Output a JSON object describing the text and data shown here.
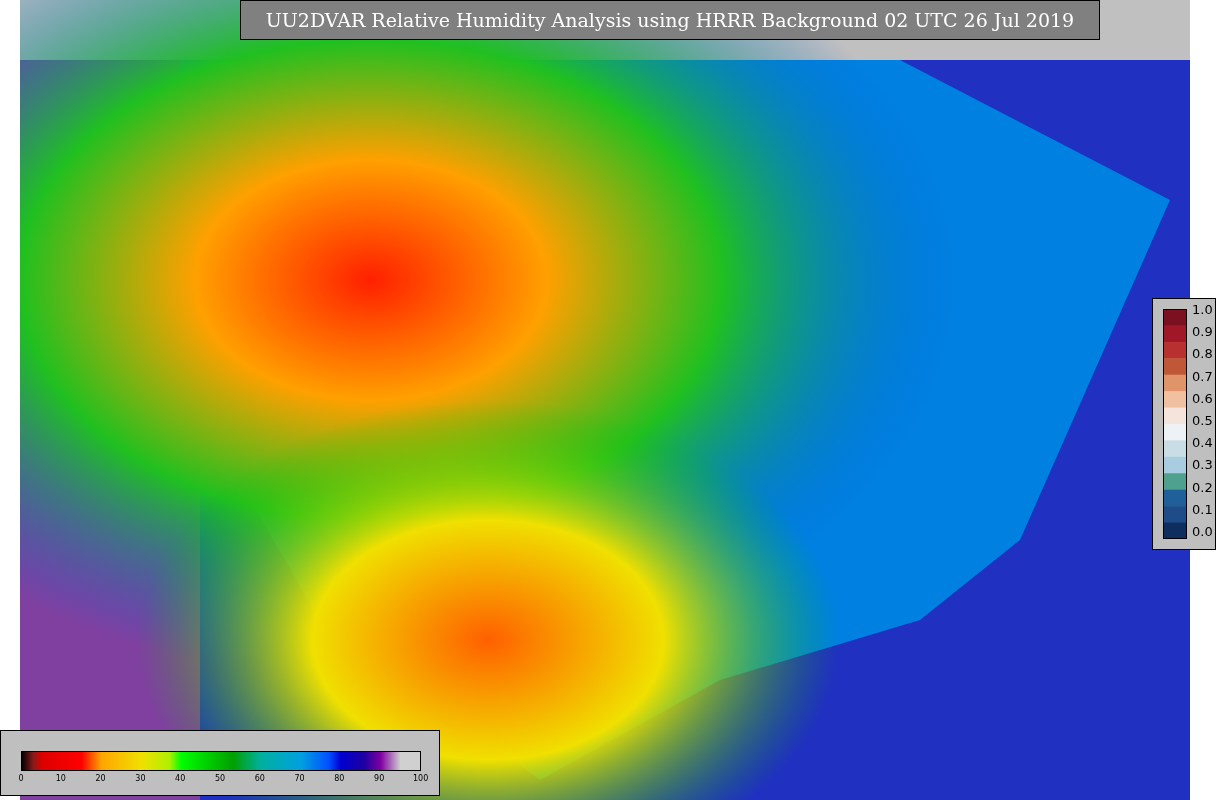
{
  "title": "UU2DVAR Relative Humidity Analysis using HRRR Background 02 UTC 26 Jul 2019",
  "right_colorbar": {
    "ticks": [
      "1.0",
      "0.9",
      "0.8",
      "0.7",
      "0.6",
      "0.5",
      "0.4",
      "0.3",
      "0.2",
      "0.1",
      "0.0"
    ]
  },
  "bottom_colorbar": {
    "ticks": [
      "0",
      "10",
      "20",
      "30",
      "40",
      "50",
      "60",
      "70",
      "80",
      "90",
      "100"
    ]
  }
}
